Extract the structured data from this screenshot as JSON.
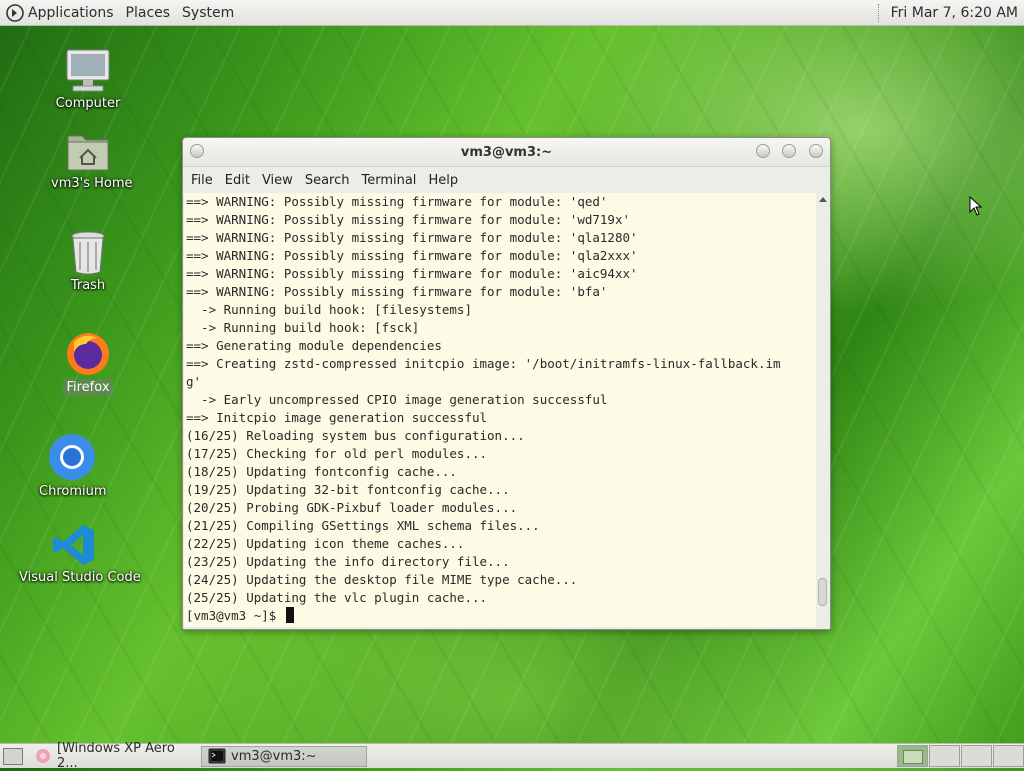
{
  "top_panel": {
    "menus": [
      "Applications",
      "Places",
      "System"
    ],
    "clock": "Fri Mar 7,  6:20 AM"
  },
  "desktop_icons": [
    {
      "label": "Computer",
      "icon": "computer-icon"
    },
    {
      "label": "vm3's Home",
      "icon": "home-folder-icon"
    },
    {
      "label": "Trash",
      "icon": "trash-icon"
    },
    {
      "label": "Firefox",
      "icon": "firefox-icon"
    },
    {
      "label": "Chromium",
      "icon": "chromium-icon"
    },
    {
      "label": "Visual Studio Code",
      "icon": "vscode-icon"
    }
  ],
  "terminal": {
    "title": "vm3@vm3:~",
    "menu": [
      "File",
      "Edit",
      "View",
      "Search",
      "Terminal",
      "Help"
    ],
    "lines": [
      "==> WARNING: Possibly missing firmware for module: 'qed'",
      "==> WARNING: Possibly missing firmware for module: 'wd719x'",
      "==> WARNING: Possibly missing firmware for module: 'qla1280'",
      "==> WARNING: Possibly missing firmware for module: 'qla2xxx'",
      "==> WARNING: Possibly missing firmware for module: 'aic94xx'",
      "==> WARNING: Possibly missing firmware for module: 'bfa'",
      "  -> Running build hook: [filesystems]",
      "  -> Running build hook: [fsck]",
      "==> Generating module dependencies",
      "==> Creating zstd-compressed initcpio image: '/boot/initramfs-linux-fallback.im",
      "g'",
      "  -> Early uncompressed CPIO image generation successful",
      "==> Initcpio image generation successful",
      "(16/25) Reloading system bus configuration...",
      "(17/25) Checking for old perl modules...",
      "(18/25) Updating fontconfig cache...",
      "(19/25) Updating 32-bit fontconfig cache...",
      "(20/25) Probing GDK-Pixbuf loader modules...",
      "(21/25) Compiling GSettings XML schema files...",
      "(22/25) Updating icon theme caches...",
      "(23/25) Updating the info directory file...",
      "(24/25) Updating the desktop file MIME type cache...",
      "(25/25) Updating the vlc plugin cache..."
    ],
    "prompt": "[vm3@vm3 ~]$ "
  },
  "taskbar": {
    "tasks": [
      {
        "label": "[Windows XP Aero 2...",
        "icon": "image-viewer-icon",
        "active": false
      },
      {
        "label": "vm3@vm3:~",
        "icon": "terminal-icon",
        "active": true
      }
    ],
    "workspaces": 4,
    "active_workspace": 1
  }
}
